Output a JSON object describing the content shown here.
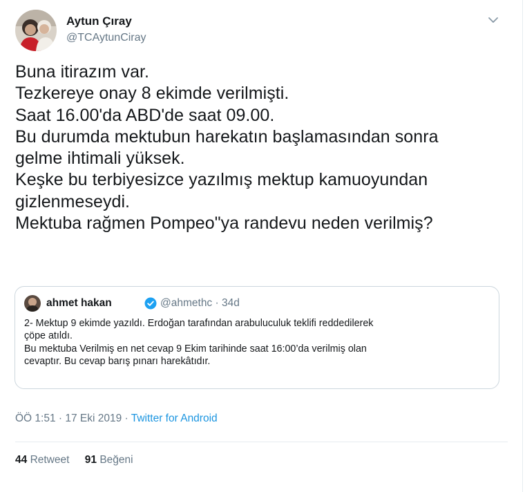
{
  "author": {
    "name": "Aytun Çıray",
    "handle": "@TCAytunCiray"
  },
  "tweet": {
    "lines": [
      "Buna itirazım var.",
      "Tezkereye onay 8 ekimde verilmişti.",
      "Saat 16.00'da ABD'de saat 09.00.",
      "Bu durumda mektubun harekatın başlamasından sonra",
      "gelme ihtimali yüksek.",
      "Keşke bu terbiyesizce yazılmış mektup kamuoyundan",
      "gizlenmeseydi.",
      "Mektuba rağmen Pompeo\"ya randevu neden verilmiş?"
    ]
  },
  "quote": {
    "name": "ahmet hakan",
    "handle_and_time": "@ahmethc · 34d",
    "lines": [
      "2- Mektup 9 ekimde yazıldı. Erdoğan tarafından arabuluculuk teklifi reddedilerek",
      "çöpe atıldı.",
      "Bu mektuba Verilmiş en net cevap 9 Ekim tarihinde saat 16:00’da verilmiş olan",
      "cevaptır. Bu cevap barış pınarı harekâtıdır."
    ]
  },
  "meta": {
    "time_date": "ÖÖ 1:51 · 17 Eki 2019 · ",
    "source": "Twitter for Android"
  },
  "stats": {
    "retweets_count": "44",
    "retweets_label": "Retweet",
    "likes_count": "91",
    "likes_label": "Beğeni"
  },
  "icons": {
    "caret": "chevron-down-icon",
    "verified": "verified-badge-icon"
  },
  "colors": {
    "link": "#1b95e0",
    "secondary_text": "#657786",
    "verified": "#1da1f2",
    "border": "#ccd6dd"
  }
}
